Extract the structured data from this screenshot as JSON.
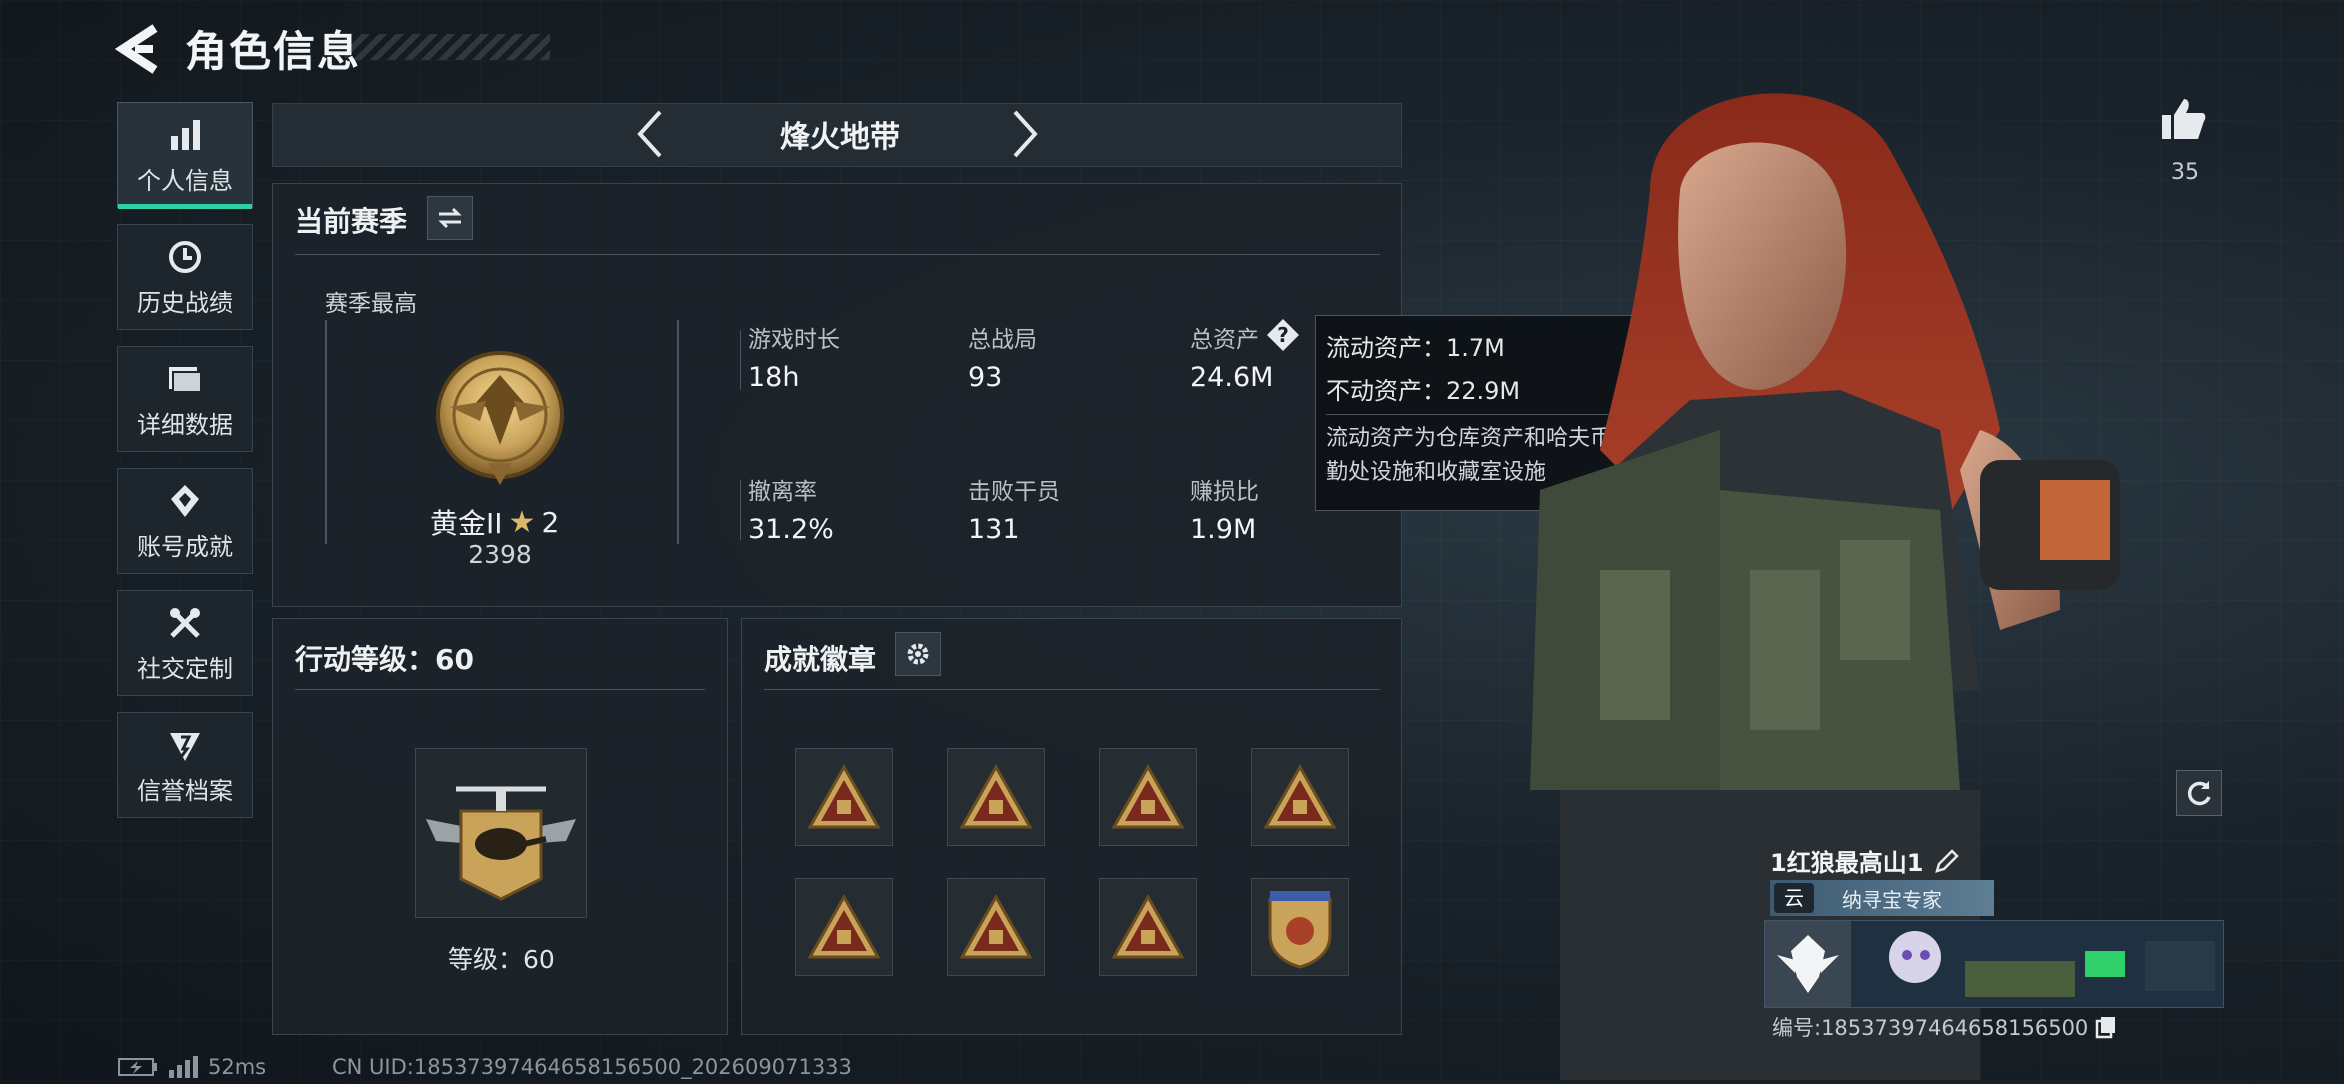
{
  "header": {
    "title": "角色信息"
  },
  "sidebar": {
    "items": [
      {
        "label": "个人信息",
        "icon": "bar-chart-icon",
        "active": true
      },
      {
        "label": "历史战绩",
        "icon": "history-clock-icon"
      },
      {
        "label": "详细数据",
        "icon": "folder-icon"
      },
      {
        "label": "账号成就",
        "icon": "achievement-icon"
      },
      {
        "label": "社交定制",
        "icon": "tools-icon"
      },
      {
        "label": "信誉档案",
        "icon": "credit-shield-icon"
      }
    ]
  },
  "mode": {
    "title": "烽火地带"
  },
  "season": {
    "title": "当前赛季",
    "best_label": "赛季最高",
    "rank_name": "黄金II",
    "rank_stars": "2",
    "rank_score": "2398",
    "stats": [
      {
        "label": "游戏时长",
        "value": "18h"
      },
      {
        "label": "总战局",
        "value": "93"
      },
      {
        "label": "总资产",
        "value": "24.6M"
      },
      {
        "label": "撤离率",
        "value": "31.2%"
      },
      {
        "label": "击败干员",
        "value": "131"
      },
      {
        "label": "赚损比",
        "value": "1.9M"
      }
    ]
  },
  "tooltip": {
    "liquid": "流动资产：1.7M",
    "fixed": "不动资产：22.9M",
    "note": "流动资产为仓库资产和哈夫币，不动资产为特勤处设施和收藏室设施"
  },
  "level": {
    "title": "行动等级：60",
    "label": "等级：60"
  },
  "badges": {
    "title": "成就徽章",
    "count": 8
  },
  "right": {
    "like_count": "35",
    "player_name": "1红狼最高山1",
    "player_title": "纳寻宝专家",
    "player_id": "编号:18537397464658156500"
  },
  "footer": {
    "ping": "52ms",
    "uid": "CN UID:18537397464658156500_202609071333"
  },
  "colors": {
    "accent": "#2fd0a5",
    "gold": "#c9a35a"
  }
}
